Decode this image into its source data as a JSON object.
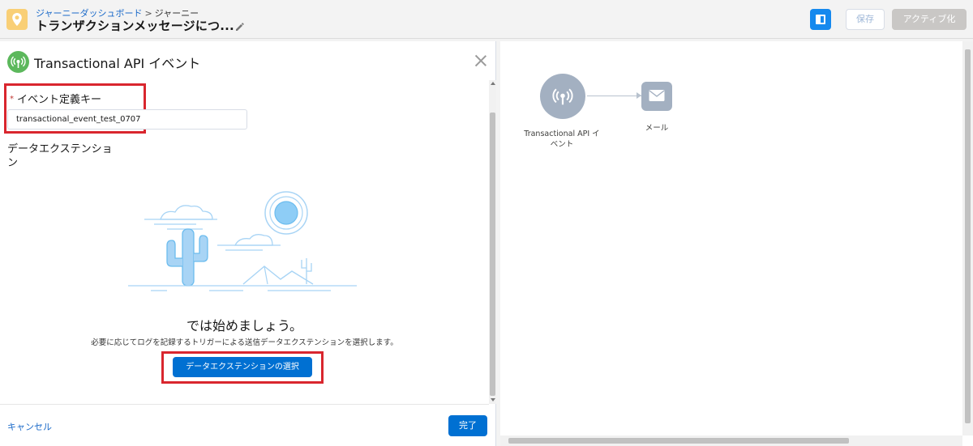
{
  "header": {
    "breadcrumb_dashboard": "ジャーニーダッシュボード",
    "breadcrumb_separator": ">",
    "breadcrumb_current": "ジャーニー",
    "journey_title": "トランザクションメッセージにつ...",
    "save_label": "保存",
    "activate_label": "アクティブ化"
  },
  "panel": {
    "title": "Transactional API イベント",
    "required_marker": "*",
    "event_key_label": "イベント定義キー",
    "event_key_value": "transactional_event_test_0707",
    "data_extension_label": "データエクステンション",
    "empty_title": "では始めましょう。",
    "empty_description": "必要に応じてログを記録するトリガーによる送信データエクステンションを選択します。",
    "select_de_button": "データエクステンションの選択",
    "cancel_label": "キャンセル",
    "done_label": "完了"
  },
  "canvas": {
    "api_node_label": "Transactional API イベント",
    "email_node_label": "メール"
  },
  "colors": {
    "primary": "#0070d2",
    "highlight": "#d9262e",
    "journey_icon": "#f9cf76",
    "api_icon": "#5cb85c",
    "node": "#a3b0c1"
  },
  "icons": [
    "map-pin-icon",
    "pencil-icon",
    "panel-toggle-icon",
    "broadcast-icon",
    "close-icon",
    "envelope-icon"
  ]
}
